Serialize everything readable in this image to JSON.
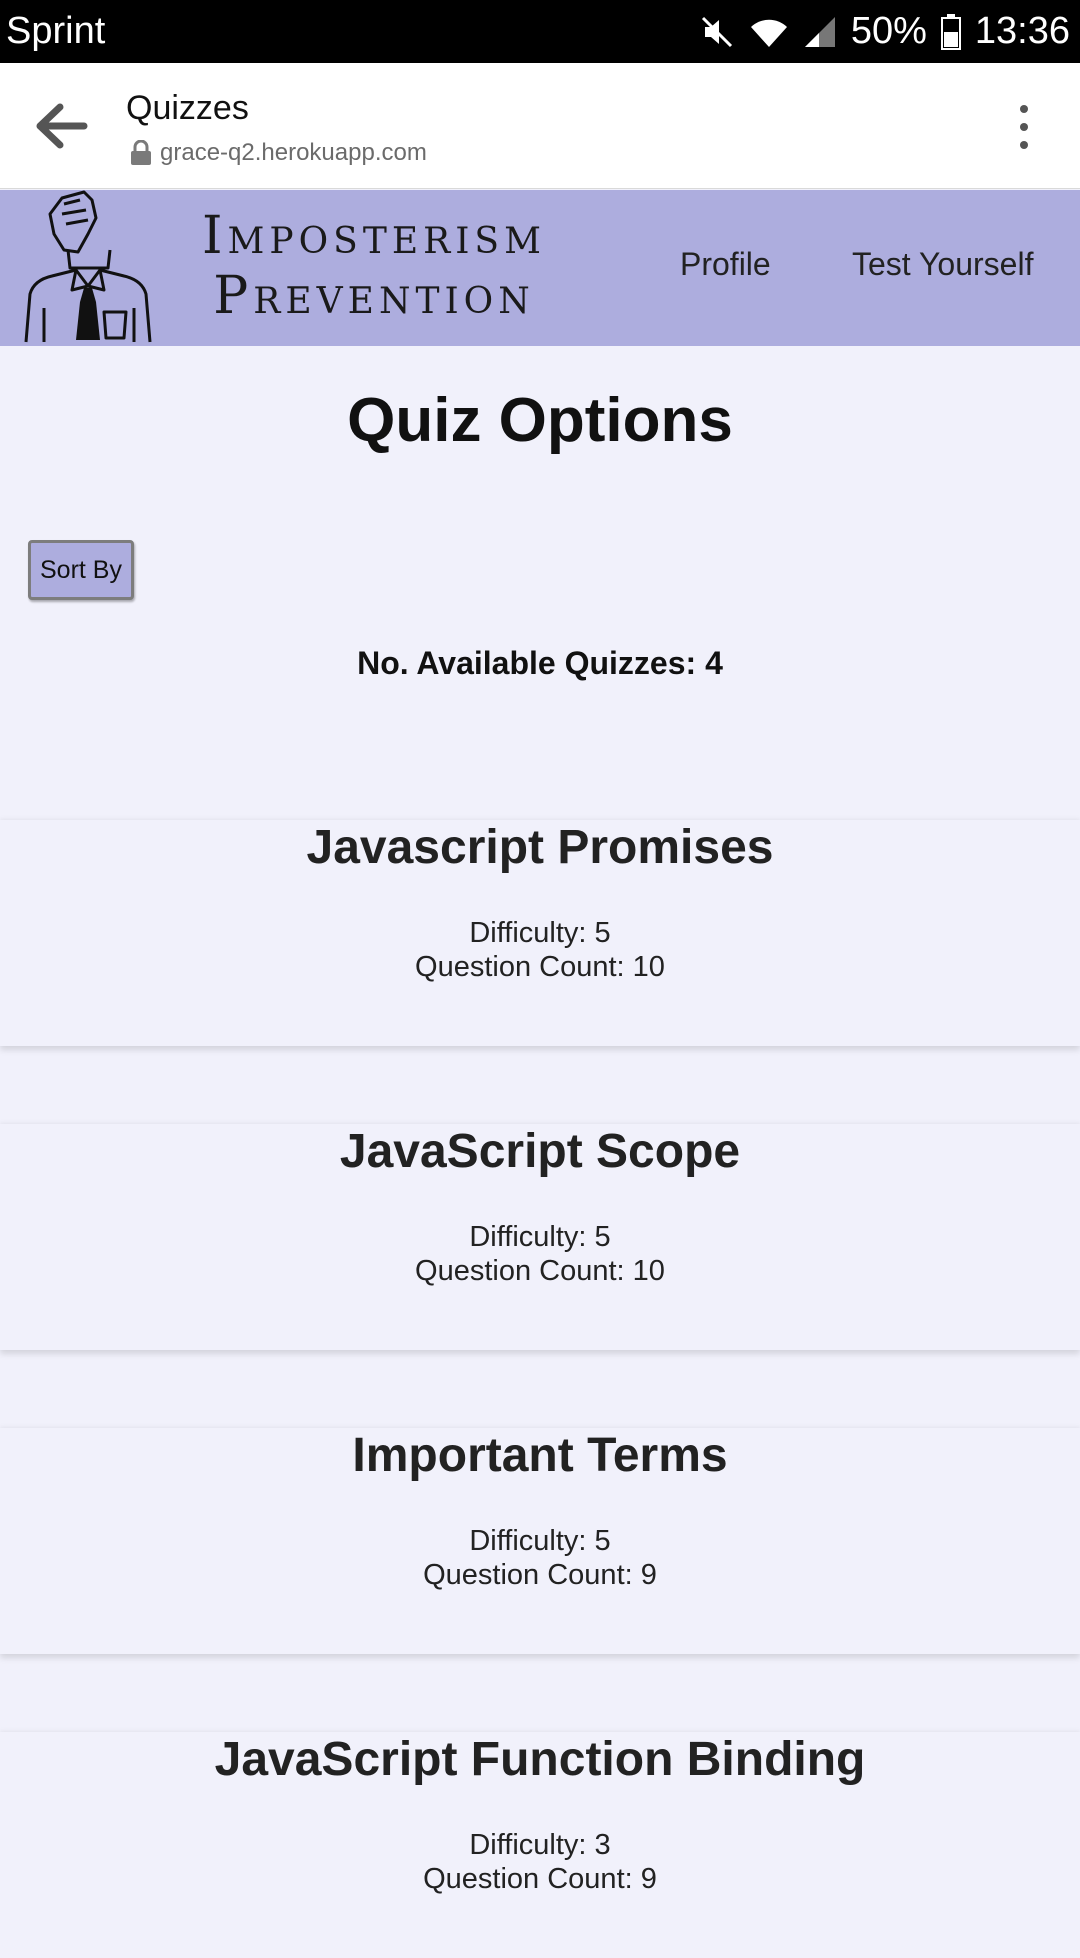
{
  "status_bar": {
    "carrier": "Sprint",
    "battery": "50%",
    "time": "13:36",
    "icons": [
      "mute-icon",
      "wifi-icon",
      "signal-icon",
      "battery-icon"
    ]
  },
  "browser": {
    "title": "Quizzes",
    "url": "grace-q2.herokuapp.com"
  },
  "site": {
    "brand_line1": "Imposterism",
    "brand_line2": "Prevention",
    "nav": {
      "profile": "Profile",
      "test_yourself": "Test Yourself"
    },
    "header_color": "#adadde"
  },
  "main": {
    "title": "Quiz Options",
    "sort_label": "Sort By",
    "available_text": "No. Available Quizzes: 4"
  },
  "quizzes": [
    {
      "title": "Javascript Promises",
      "difficulty": "Difficulty: 5",
      "count": "Question Count: 10"
    },
    {
      "title": "JavaScript Scope",
      "difficulty": "Difficulty: 5",
      "count": "Question Count: 10"
    },
    {
      "title": "Important Terms",
      "difficulty": "Difficulty: 5",
      "count": "Question Count: 9"
    },
    {
      "title": "JavaScript Function Binding",
      "difficulty": "Difficulty: 3",
      "count": "Question Count: 9"
    }
  ]
}
